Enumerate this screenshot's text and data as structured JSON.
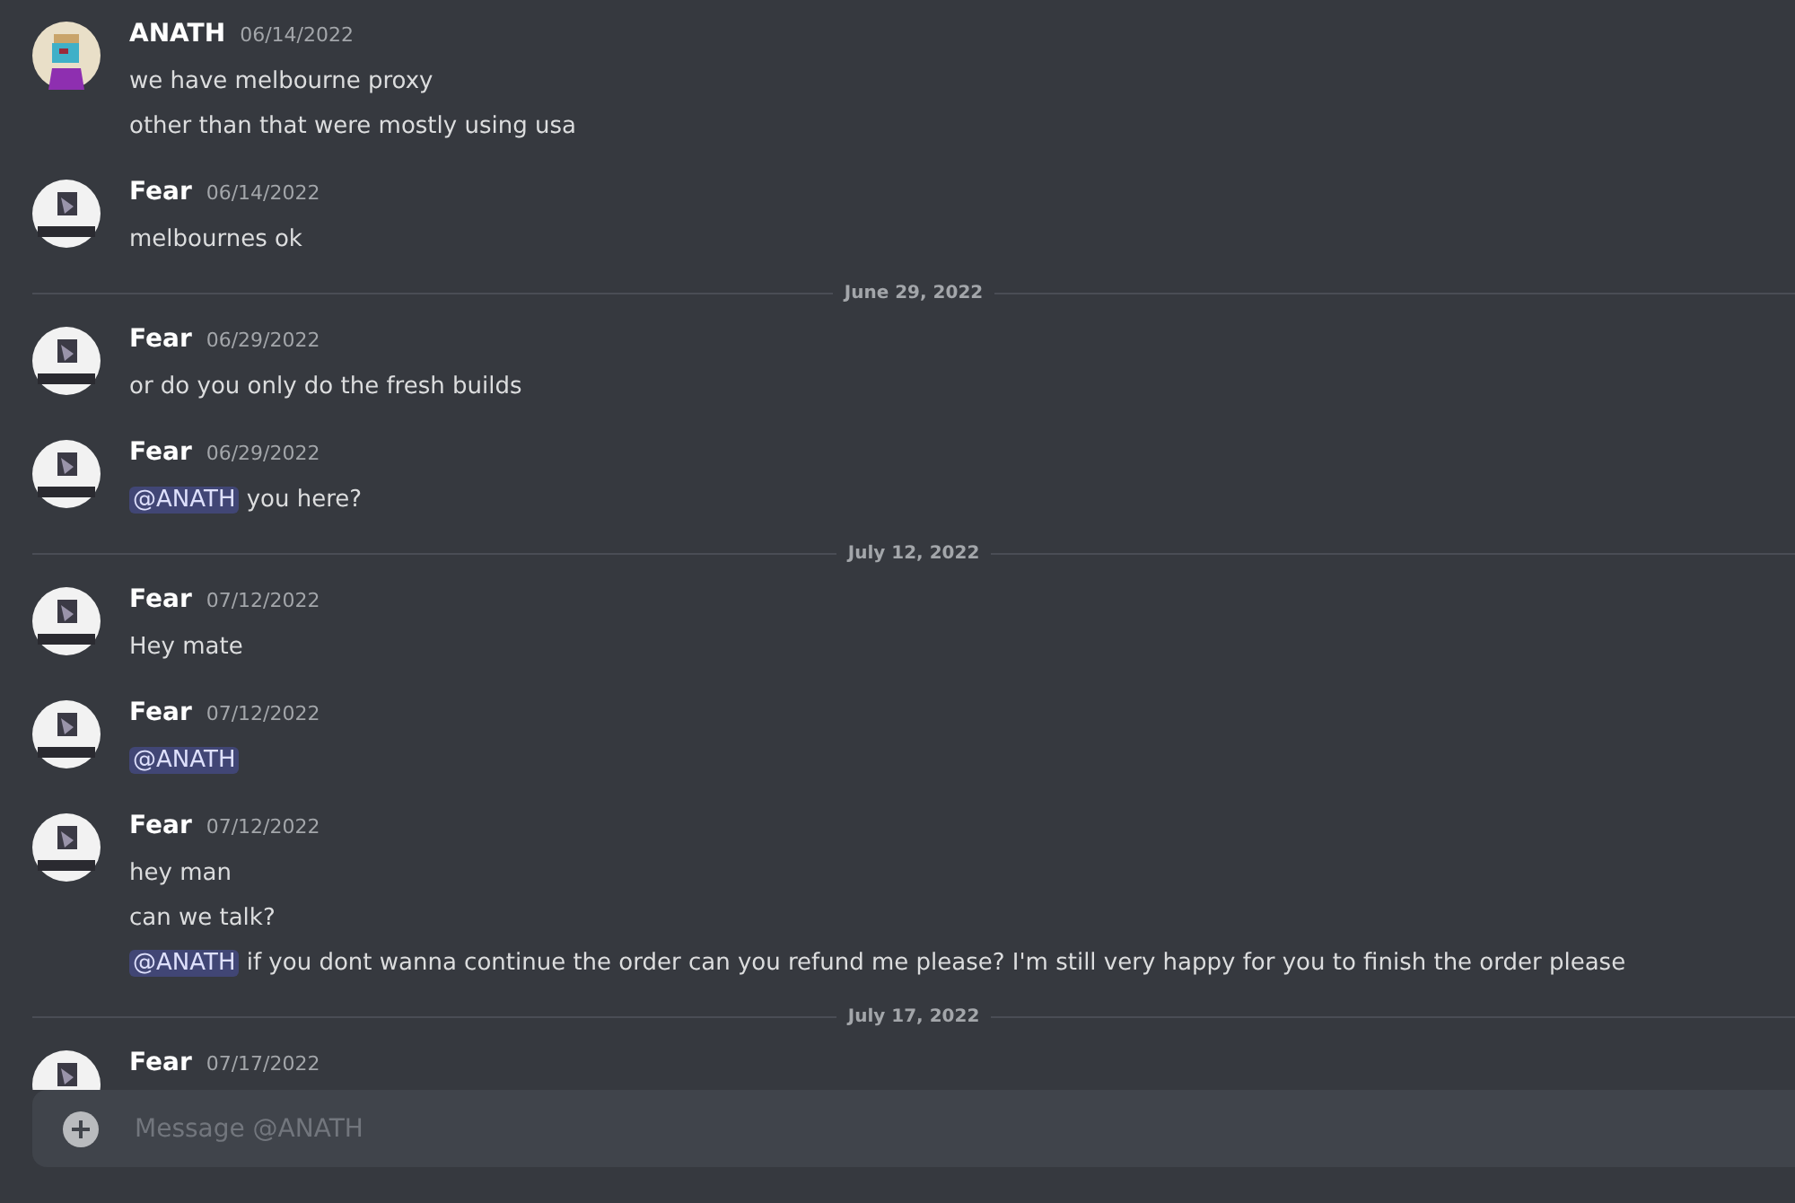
{
  "feed": [
    {
      "kind": "message",
      "author": "ANATH",
      "avatar": {
        "kind": "pixel"
      },
      "time": "06/14/2022",
      "lines": [
        [
          {
            "text": "we have melbourne proxy"
          }
        ],
        [
          {
            "text": "other than that were mostly using usa"
          }
        ]
      ]
    },
    {
      "kind": "message",
      "author": "Fear",
      "avatar": {
        "kind": "logo"
      },
      "time": "06/14/2022",
      "lines": [
        [
          {
            "text": "melbournes ok"
          }
        ]
      ]
    },
    {
      "kind": "divider",
      "label": "June 29, 2022"
    },
    {
      "kind": "message",
      "author": "Fear",
      "avatar": {
        "kind": "logo"
      },
      "time": "06/29/2022",
      "lines": [
        [
          {
            "text": "or do you only do the fresh builds"
          }
        ]
      ]
    },
    {
      "kind": "message",
      "author": "Fear",
      "avatar": {
        "kind": "logo"
      },
      "time": "06/29/2022",
      "lines": [
        [
          {
            "mention": "@ANATH"
          },
          {
            "text": " you here?"
          }
        ]
      ]
    },
    {
      "kind": "divider",
      "label": "July 12, 2022"
    },
    {
      "kind": "message",
      "author": "Fear",
      "avatar": {
        "kind": "logo"
      },
      "time": "07/12/2022",
      "lines": [
        [
          {
            "text": "Hey mate"
          }
        ]
      ]
    },
    {
      "kind": "message",
      "author": "Fear",
      "avatar": {
        "kind": "logo"
      },
      "time": "07/12/2022",
      "lines": [
        [
          {
            "mention": "@ANATH"
          }
        ]
      ]
    },
    {
      "kind": "message",
      "author": "Fear",
      "avatar": {
        "kind": "logo"
      },
      "time": "07/12/2022",
      "lines": [
        [
          {
            "text": "hey man"
          }
        ],
        [
          {
            "text": "can we talk?"
          }
        ],
        [
          {
            "mention": "@ANATH"
          },
          {
            "text": " if you dont wanna continue the order can you refund me please? I'm still very happy for you to finish the order please"
          }
        ]
      ]
    },
    {
      "kind": "divider",
      "label": "July 17, 2022"
    },
    {
      "kind": "message",
      "author": "Fear",
      "avatar": {
        "kind": "logo"
      },
      "time": "07/17/2022"
    }
  ],
  "composer": {
    "placeholder": "Message @ANATH"
  }
}
